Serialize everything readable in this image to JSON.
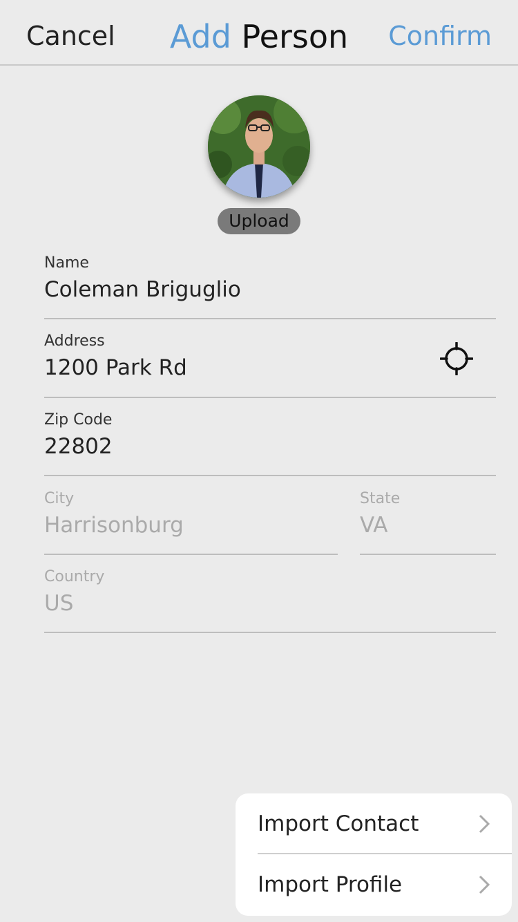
{
  "header": {
    "cancel_label": "Cancel",
    "title_accent": "Add",
    "title_rest": "Person",
    "confirm_label": "Confirm"
  },
  "colors": {
    "accent": "#5b9bd5",
    "background": "#ebebeb",
    "disabled_text": "#aaaaaa"
  },
  "avatar": {
    "upload_label": "Upload"
  },
  "form": {
    "name": {
      "label": "Name",
      "value": "Coleman Briguglio"
    },
    "address": {
      "label": "Address",
      "value": "1200 Park Rd",
      "icon": "locate-crosshair-icon"
    },
    "zip": {
      "label": "Zip Code",
      "value": "22802"
    },
    "city": {
      "label": "City",
      "value": "Harrisonburg"
    },
    "state": {
      "label": "State",
      "value": "VA"
    },
    "country": {
      "label": "Country",
      "value": "US"
    }
  },
  "import_menu": {
    "items": [
      {
        "label": "Import Contact",
        "icon": "chevron-right-icon"
      },
      {
        "label": "Import Profile",
        "icon": "chevron-right-icon"
      }
    ]
  }
}
